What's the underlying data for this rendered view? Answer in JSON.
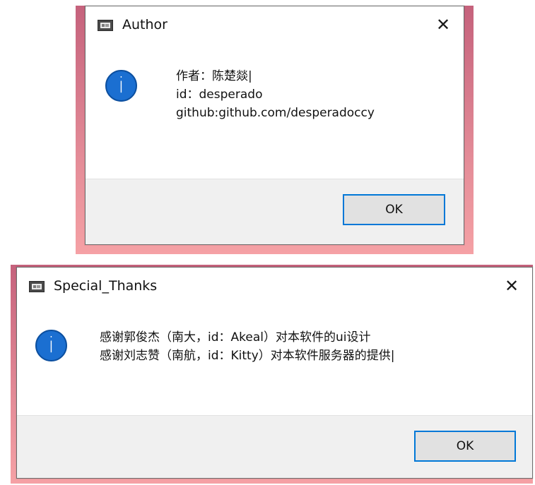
{
  "dialogs": [
    {
      "title": "Author",
      "lines": [
        "作者：陈楚燚|",
        "id：desperado",
        "github:github.com/desperadoccy"
      ],
      "ok_label": "OK",
      "close_glyph": "✕",
      "info_glyph": "i"
    },
    {
      "title": "Special_Thanks",
      "lines": [
        "感谢郭俊杰（南大，id：Akeal）对本软件的ui设计",
        "感谢刘志赞（南航，id：Kitty）对本软件服务器的提供|"
      ],
      "ok_label": "OK",
      "close_glyph": "✕",
      "info_glyph": "i"
    }
  ]
}
